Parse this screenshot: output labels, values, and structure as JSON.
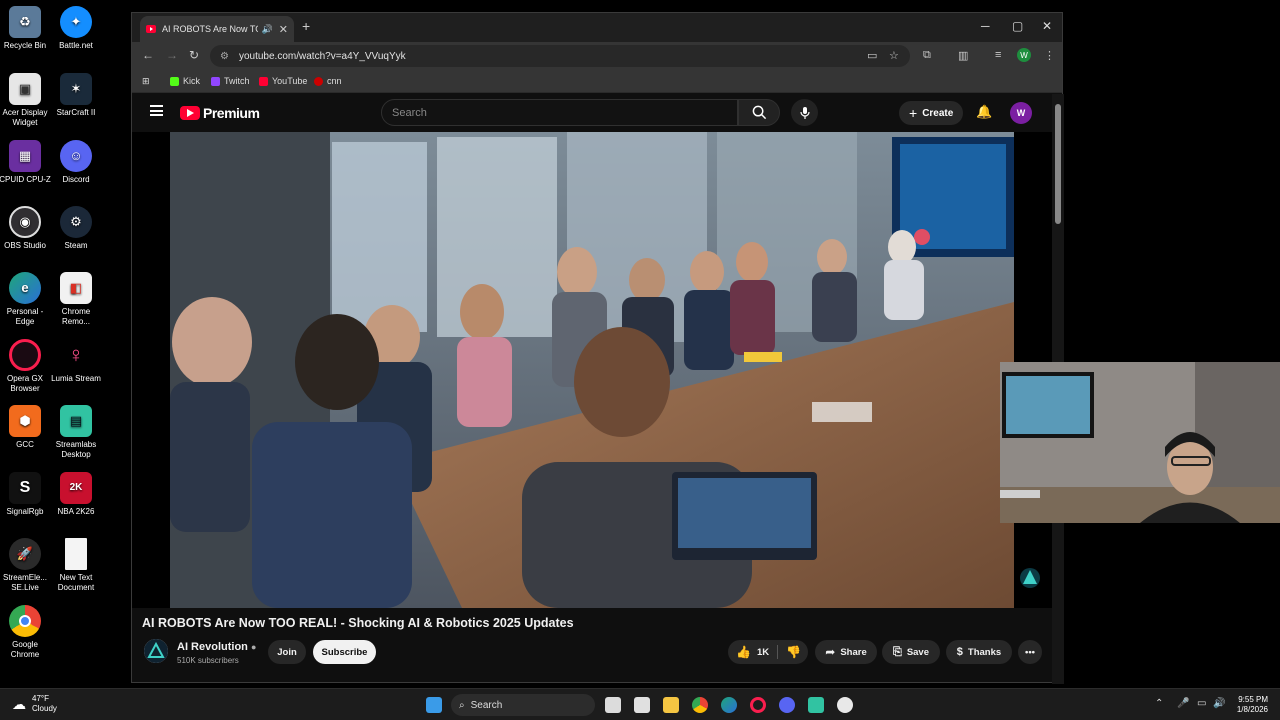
{
  "desktop": {
    "icons": [
      {
        "label": "Recycle Bin"
      },
      {
        "label": "Battle.net"
      },
      {
        "label": "Acer Display Widget"
      },
      {
        "label": "StarCraft II"
      },
      {
        "label": "CPUID CPU-Z"
      },
      {
        "label": "Discord"
      },
      {
        "label": "OBS Studio"
      },
      {
        "label": "Steam"
      },
      {
        "label": "Personal - Edge"
      },
      {
        "label": "Chrome Remo..."
      },
      {
        "label": "Opera GX Browser"
      },
      {
        "label": "Lumia Stream"
      },
      {
        "label": "GCC"
      },
      {
        "label": "Streamlabs Desktop"
      },
      {
        "label": "SignalRgb"
      },
      {
        "label": "NBA 2K26"
      },
      {
        "label": "StreamEle... SE.Live"
      },
      {
        "label": "New Text Document"
      },
      {
        "label": "Google Chrome"
      }
    ]
  },
  "browser": {
    "tab_title": "AI ROBOTS Are Now TOO REAL",
    "url": "youtube.com/watch?v=a4Y_VVuqYyk",
    "profile_initial": "W",
    "bookmarks": [
      {
        "label": "Kick",
        "color": "#53fc18"
      },
      {
        "label": "Twitch",
        "color": "#9146ff"
      },
      {
        "label": "YouTube",
        "color": "#ff0033"
      },
      {
        "label": "cnn",
        "color": "#cc0000"
      }
    ]
  },
  "youtube": {
    "logo_text": "Premium",
    "search_placeholder": "Search",
    "create_label": "Create",
    "avatar_initial": "W",
    "video_title": "AI ROBOTS Are Now TOO REAL! - Shocking AI & Robotics 2025 Updates",
    "channel_name": "AI Revolution",
    "subscribers": "510K subscribers",
    "join_label": "Join",
    "subscribe_label": "Subscribe",
    "likes": "1K",
    "share_label": "Share",
    "save_label": "Save",
    "thanks_label": "Thanks"
  },
  "taskbar": {
    "temperature": "47°F",
    "condition": "Cloudy",
    "search_label": "Search",
    "time": "9:55 PM",
    "date": "1/8/2026"
  },
  "colors": {
    "youtube_red": "#ff0033",
    "brand_purple": "#7b1fa2"
  }
}
